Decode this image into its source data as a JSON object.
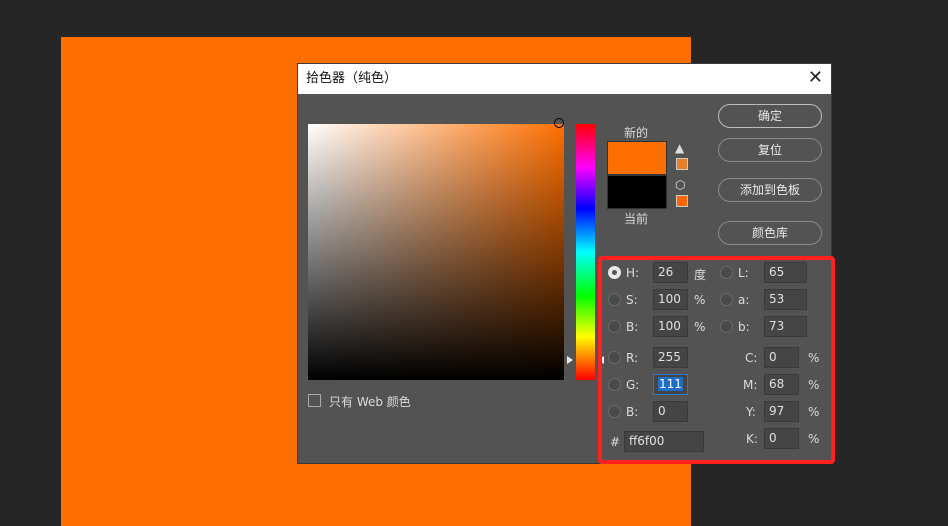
{
  "canvas_color": "#ff6f00",
  "dialog": {
    "title": "拾色器（纯色）",
    "close": "✕"
  },
  "swatch": {
    "new_label": "新的",
    "current_label": "当前",
    "new_color": "#ff6f00",
    "current_color": "#000000",
    "gamut_warning_color": "#e87f2a",
    "websafe_color": "#ff6600"
  },
  "buttons": {
    "ok": "确定",
    "reset": "复位",
    "add_swatch": "添加到色板",
    "color_libraries": "颜色库"
  },
  "web_only": {
    "label": "只有 Web 颜色",
    "checked": false
  },
  "fields": {
    "H": {
      "label": "H:",
      "value": "26",
      "unit": "度"
    },
    "S": {
      "label": "S:",
      "value": "100",
      "unit": "%"
    },
    "Bv": {
      "label": "B:",
      "value": "100",
      "unit": "%"
    },
    "R": {
      "label": "R:",
      "value": "255"
    },
    "G": {
      "label": "G:",
      "value": "111"
    },
    "B": {
      "label": "B:",
      "value": "0"
    },
    "L": {
      "label": "L:",
      "value": "65"
    },
    "a": {
      "label": "a:",
      "value": "53"
    },
    "b": {
      "label": "b:",
      "value": "73"
    },
    "C": {
      "label": "C:",
      "value": "0",
      "unit": "%"
    },
    "M": {
      "label": "M:",
      "value": "68",
      "unit": "%"
    },
    "Y": {
      "label": "Y:",
      "value": "97",
      "unit": "%"
    },
    "K": {
      "label": "K:",
      "value": "0",
      "unit": "%"
    },
    "hex": {
      "label": "#",
      "value": "ff6f00"
    }
  },
  "highlight_color": "#ff2020"
}
